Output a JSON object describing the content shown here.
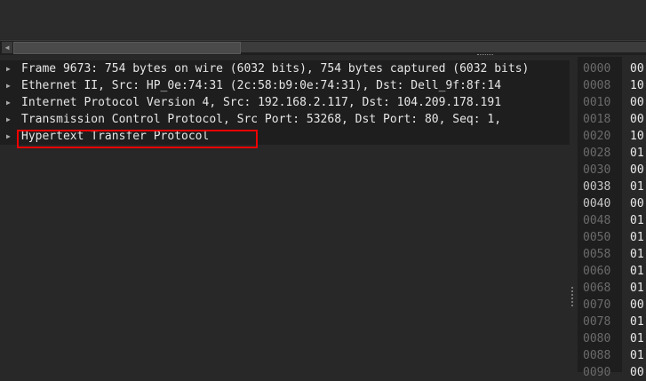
{
  "tree": [
    "Frame 9673: 754 bytes on wire (6032 bits), 754 bytes captured (6032 bits)",
    "Ethernet II, Src: HP_0e:74:31 (2c:58:b9:0e:74:31), Dst: Dell_9f:8f:14",
    "Internet Protocol Version 4, Src: 192.168.2.117, Dst: 104.209.178.191",
    "Transmission Control Protocol, Src Port: 53268, Dst Port: 80, Seq: 1,",
    "Hypertext Transfer Protocol"
  ],
  "hex": {
    "offsets": [
      "0000",
      "0008",
      "0010",
      "0018",
      "0020",
      "0028",
      "0030",
      "0038",
      "0040",
      "0048",
      "0050",
      "0058",
      "0060",
      "0068",
      "0070",
      "0078",
      "0080",
      "0088",
      "0090"
    ],
    "bytes": [
      "00",
      "10",
      "00",
      "00",
      "10",
      "01",
      "00",
      "01",
      "00",
      "01",
      "01",
      "01",
      "01",
      "01",
      "00",
      "01",
      "01",
      "01",
      "00"
    ],
    "highlighted_offsets": [
      "0038",
      "0040"
    ]
  },
  "colors": {
    "highlight_box": "#ee0000"
  }
}
